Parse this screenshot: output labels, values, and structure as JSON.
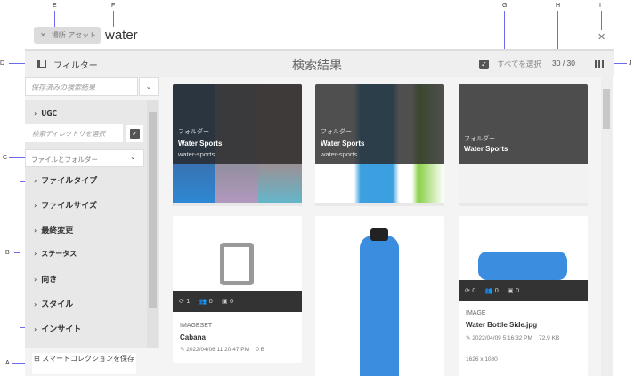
{
  "callouts": {
    "A": "A",
    "B": "B",
    "C": "C",
    "D": "D",
    "E": "E",
    "F": "F",
    "G": "G",
    "H": "H",
    "I": "I",
    "J": "J"
  },
  "search": {
    "chip_label": "場所 アセット",
    "query": "water"
  },
  "header": {
    "filter_label": "フィルター",
    "title": "検索結果",
    "select_all": "すべてを選択",
    "count": "30 / 30"
  },
  "sidebar": {
    "saved_search_placeholder": "保存済みの検索結果",
    "ugc": "UGC",
    "search_dir_placeholder": "検索ディレクトリを選択",
    "file_folder": "ファイルとフォルダー",
    "items": [
      "ファイルタイプ",
      "ファイルサイズ",
      "最終変更",
      "ステータス",
      "向き",
      "スタイル",
      "インサイト"
    ],
    "save_collection": "スマートコレクションを保存"
  },
  "cards": [
    {
      "type": "フォルダー",
      "name": "Water Sports",
      "slug": "water-sports"
    },
    {
      "type": "フォルダー",
      "name": "Water Sports",
      "slug": "water-sports"
    },
    {
      "type": "フォルダー",
      "name": "Water Sports"
    },
    {
      "kind": "IMAGESET",
      "name": "Cabana",
      "date": "2022/04/06",
      "time": "11:20:47 PM",
      "size": "0 B",
      "stats": [
        "1",
        "0",
        "0"
      ]
    },
    {
      "kind": "IMAGE",
      "name": "Water Bottle Side.jpg",
      "date": "2022/04/09",
      "time": "5:16:32 PM",
      "size": "72.9 KB",
      "dims": "1626 x 1080",
      "stats": [
        "0",
        "0",
        "0"
      ]
    }
  ],
  "colors": {
    "dark_overlay": "#333333",
    "bottle_blue": "#3b8de0"
  }
}
